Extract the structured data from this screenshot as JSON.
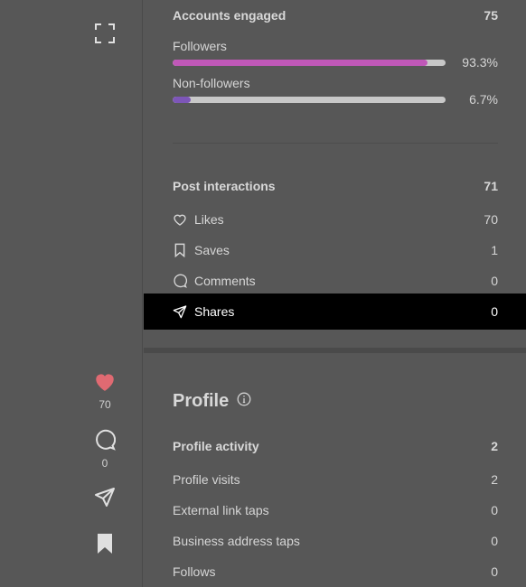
{
  "side": {
    "likes_count": "70",
    "comments_count": "0"
  },
  "accounts": {
    "title": "Accounts engaged",
    "total": "75",
    "followers_label": "Followers",
    "followers_pct": "93.3%",
    "followers_fraction": 0.933,
    "nonfollowers_label": "Non-followers",
    "nonfollowers_pct": "6.7%",
    "nonfollowers_fraction": 0.067,
    "followers_color": "#c058b8",
    "nonfollowers_color": "#7d56b8"
  },
  "interactions": {
    "title": "Post interactions",
    "total": "71",
    "items": [
      {
        "label": "Likes",
        "value": "70"
      },
      {
        "label": "Saves",
        "value": "1"
      },
      {
        "label": "Comments",
        "value": "0"
      },
      {
        "label": "Shares",
        "value": "0"
      }
    ]
  },
  "profile": {
    "title": "Profile",
    "activity_label": "Profile activity",
    "activity_total": "2",
    "items": [
      {
        "label": "Profile visits",
        "value": "2"
      },
      {
        "label": "External link taps",
        "value": "0"
      },
      {
        "label": "Business address taps",
        "value": "0"
      },
      {
        "label": "Follows",
        "value": "0"
      }
    ]
  },
  "colors": {
    "heart": "#e06a72",
    "highlight": "#000000"
  }
}
